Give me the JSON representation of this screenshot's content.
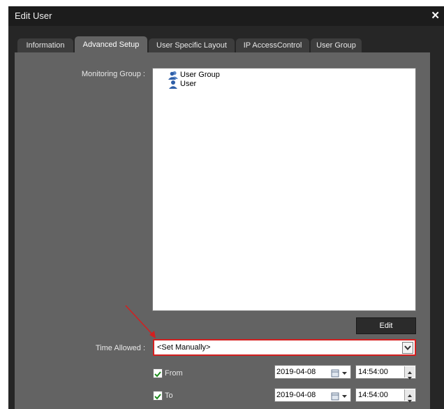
{
  "window": {
    "title": "Edit User"
  },
  "tabs": [
    {
      "label": "Information"
    },
    {
      "label": "Advanced Setup"
    },
    {
      "label": "User Specific Layout"
    },
    {
      "label": "IP AccessControl"
    },
    {
      "label": "User Group"
    }
  ],
  "monitoring": {
    "label": "Monitoring Group :",
    "items": [
      {
        "label": "User Group",
        "icon": "user-group-icon"
      },
      {
        "label": "User",
        "icon": "user-icon"
      }
    ],
    "edit_button": "Edit"
  },
  "time_allowed": {
    "label": "Time Allowed :",
    "value": "<Set Manually>"
  },
  "from": {
    "label": "From",
    "checked": true,
    "date": "2019-04-08",
    "time": "14:54:00"
  },
  "to": {
    "label": "To",
    "checked": true,
    "date": "2019-04-08",
    "time": "14:54:00"
  },
  "colors": {
    "highlight": "#d41f1f",
    "panel": "#636363",
    "window": "#262626"
  }
}
